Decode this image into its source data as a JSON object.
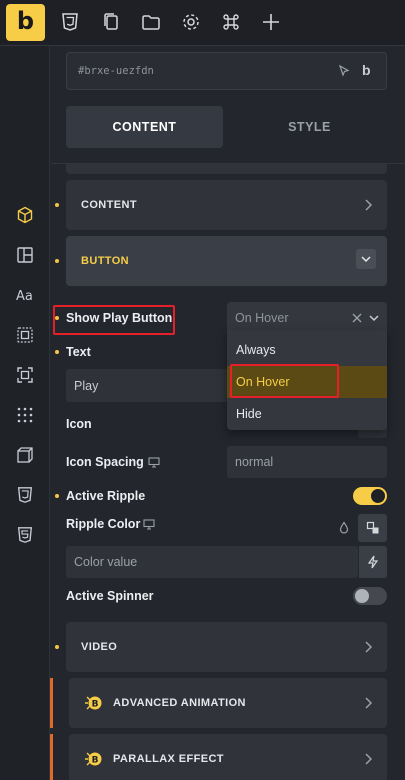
{
  "app": {
    "logo_letter": "b"
  },
  "toolbar": {
    "icons": [
      "css3-icon",
      "pages-icon",
      "folder-icon",
      "settings-icon",
      "command-icon",
      "plus-icon"
    ]
  },
  "element": {
    "id": "#brxe-uezfdn"
  },
  "tabs": {
    "content": "CONTENT",
    "style": "STYLE"
  },
  "sections": {
    "content": "CONTENT",
    "button": "BUTTON",
    "video": "VIDEO",
    "advanced_animation": "ADVANCED ANIMATION",
    "parallax_effect": "PARALLAX EFFECT",
    "badge_letter": "B"
  },
  "controls": {
    "show_play_button": {
      "label": "Show Play Button",
      "value": "On Hover"
    },
    "text": {
      "label": "Text",
      "value": "Play"
    },
    "icon": {
      "label": "Icon"
    },
    "icon_spacing": {
      "label": "Icon Spacing",
      "placeholder": "normal"
    },
    "active_ripple": {
      "label": "Active Ripple",
      "on": true
    },
    "ripple_color": {
      "label": "Ripple Color",
      "placeholder": "Color value"
    },
    "active_spinner": {
      "label": "Active Spinner",
      "on": false
    }
  },
  "dropdown": {
    "options": [
      "Always",
      "On Hover",
      "Hide"
    ],
    "selected": "On Hover"
  },
  "colors": {
    "accent": "#f7cd47",
    "highlight": "#e5202a",
    "orange": "#e06a2b"
  }
}
